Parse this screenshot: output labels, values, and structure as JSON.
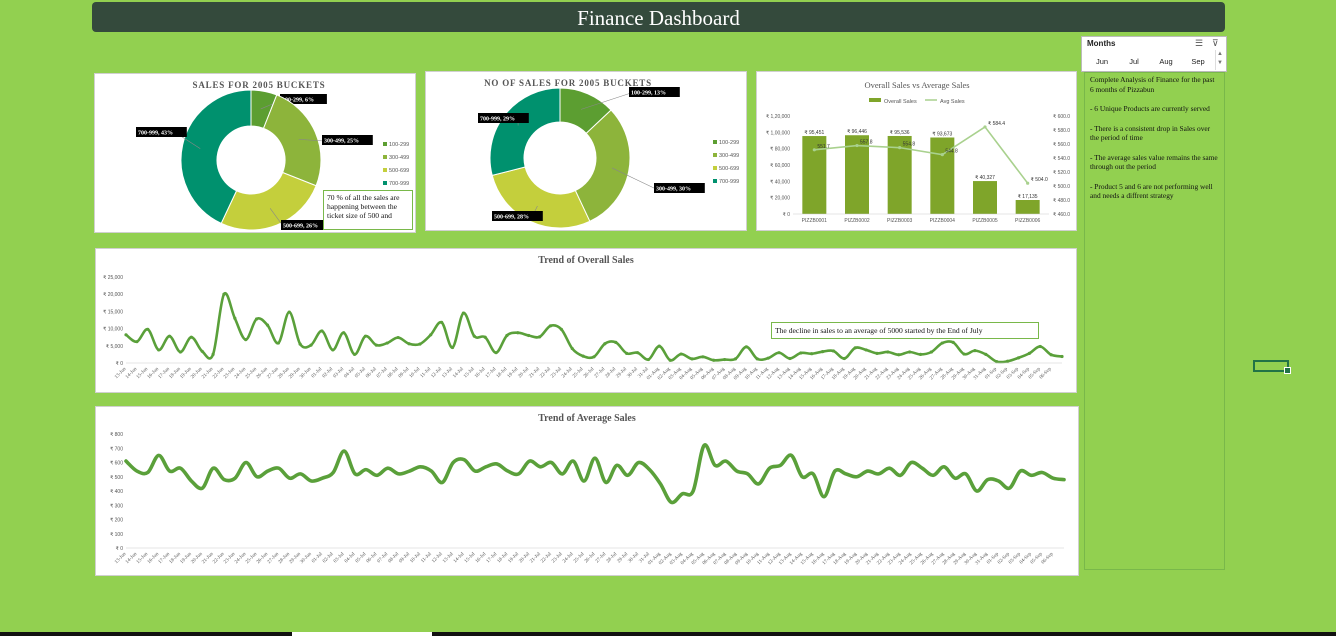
{
  "dashboard": {
    "title": "Finance Dashboard"
  },
  "slicer": {
    "title": "Months",
    "months": [
      "Jun",
      "Jul",
      "Aug",
      "Sep"
    ]
  },
  "notes": [
    "Complete Analysis of Finance for the past 6 months of Pizzabun",
    "- 6 Unique Products are currently served",
    "- There is a consistent drop in Sales over the period of time",
    "- The average sales value remains the same through out the period",
    "- Product 5 and 6 are not performing well and needs a diffrent strategy"
  ],
  "callouts": {
    "donut1": "70 % of all the sales are happening between the ticket size of 500 and",
    "trend": "The decline in sales to an average of 5000 started by the End of July"
  },
  "colors": {
    "background": "#92d050",
    "title_bar": "#344a3c",
    "seg_100_299": "#5c9e31",
    "seg_300_499": "#8db43b",
    "seg_500_699": "#c4cf3c",
    "seg_700_999": "#00916e",
    "bar": "#7fa52a",
    "avg_line": "#a9d18e",
    "trend_line": "#5aa03a"
  },
  "chart_data": [
    {
      "type": "pie",
      "title": "SALES FOR 2005 BUCKETS",
      "categories": [
        "100-299",
        "300-499",
        "500-699",
        "700-999"
      ],
      "values": [
        6,
        25,
        26,
        43
      ],
      "data_labels": [
        "100-299, 6%",
        "300-499, 25%",
        "500-699, 26%",
        "700-999, 43%"
      ],
      "legend": [
        "100-299",
        "300-499",
        "500-699",
        "700-999"
      ],
      "legend_position": "right"
    },
    {
      "type": "pie",
      "title": "NO OF SALES FOR 2005 BUCKETS",
      "categories": [
        "100-299",
        "300-499",
        "500-699",
        "700-999"
      ],
      "values": [
        13,
        30,
        28,
        29
      ],
      "data_labels": [
        "100-299, 13%",
        "300-499, 30%",
        "500-699, 28%",
        "700-999, 29%"
      ],
      "legend": [
        "100-299",
        "300-499",
        "500-699",
        "700-999"
      ],
      "legend_position": "right"
    },
    {
      "type": "bar",
      "title": "Overall Sales vs Average Sales",
      "categories": [
        "PIZZB0001",
        "PIZZB0002",
        "PIZZB0003",
        "PIZZB0004",
        "PIZZB0005",
        "PIZZB0006"
      ],
      "series": [
        {
          "name": "Overall Sales",
          "values": [
            95451,
            96446,
            95536,
            93673,
            40327,
            17135
          ],
          "labels": [
            "₹ 95,451",
            "₹ 96,446",
            "₹ 95,536",
            "₹ 93,673",
            "₹ 40,327",
            "₹ 17,135"
          ]
        },
        {
          "name": "Avg Sales",
          "values": [
            551.7,
            557.8,
            554.8,
            544.8,
            584.4,
            504.0
          ],
          "labels": [
            "551.7",
            "557.8",
            "554.8",
            "544.8",
            "₹ 584.4",
            "₹ 504.0"
          ]
        }
      ],
      "y_ticks": [
        "₹ 0",
        "₹ 20,000",
        "₹ 40,000",
        "₹ 60,000",
        "₹ 80,000",
        "₹ 1,00,000",
        "₹ 1,20,000"
      ],
      "y2_ticks": [
        "₹ 460.0",
        "₹ 480.0",
        "₹ 500.0",
        "₹ 520.0",
        "₹ 540.0",
        "₹ 560.0",
        "₹ 580.0",
        "₹ 600.0"
      ],
      "ylim": [
        0,
        120000
      ],
      "y2lim": [
        460,
        600
      ],
      "legend_position": "top"
    },
    {
      "type": "line",
      "title": "Trend of Overall Sales",
      "x": [
        "13-Jun",
        "14-Jun",
        "15-Jun",
        "16-Jun",
        "17-Jun",
        "18-Jun",
        "19-Jun",
        "20-Jun",
        "21-Jun",
        "22-Jun",
        "23-Jun",
        "24-Jun",
        "25-Jun",
        "26-Jun",
        "27-Jun",
        "28-Jun",
        "29-Jun",
        "30-Jun",
        "01-Jul",
        "02-Jul",
        "03-Jul",
        "04-Jul",
        "05-Jul",
        "06-Jul",
        "07-Jul",
        "08-Jul",
        "09-Jul",
        "10-Jul",
        "11-Jul",
        "12-Jul",
        "13-Jul",
        "14-Jul",
        "15-Jul",
        "16-Jul",
        "17-Jul",
        "18-Jul",
        "19-Jul",
        "20-Jul",
        "21-Jul",
        "22-Jul",
        "23-Jul",
        "24-Jul",
        "25-Jul",
        "26-Jul",
        "27-Jul",
        "28-Jul",
        "29-Jul",
        "30-Jul",
        "31-Jul",
        "01-Aug",
        "02-Aug",
        "03-Aug",
        "04-Aug",
        "05-Aug",
        "06-Aug",
        "07-Aug",
        "08-Aug",
        "09-Aug",
        "10-Aug",
        "11-Aug",
        "12-Aug",
        "13-Aug",
        "14-Aug",
        "15-Aug",
        "16-Aug",
        "17-Aug",
        "18-Aug",
        "19-Aug",
        "20-Aug",
        "21-Aug",
        "22-Aug",
        "23-Aug",
        "24-Aug",
        "25-Aug",
        "26-Aug",
        "27-Aug",
        "28-Aug",
        "29-Aug",
        "30-Aug",
        "31-Aug",
        "01-Sep",
        "02-Sep",
        "03-Sep",
        "04-Sep",
        "05-Sep",
        "06-Sep"
      ],
      "values": [
        8200,
        6200,
        9800,
        3800,
        7800,
        3200,
        7500,
        3400,
        2500,
        20000,
        13000,
        6800,
        12800,
        11000,
        5800,
        14800,
        5500,
        5200,
        9300,
        3800,
        8800,
        2500,
        7800,
        5200,
        5800,
        7400,
        5600,
        5500,
        8200,
        11800,
        4500,
        14500,
        7800,
        7500,
        3000,
        8000,
        8800,
        8000,
        7600,
        10800,
        9800,
        4200,
        2000,
        1800,
        5600,
        6000,
        2800,
        3000,
        1000,
        4900,
        800,
        2600,
        1200,
        1800,
        800,
        1000,
        1200,
        4700,
        1200,
        1400,
        3000,
        1300,
        2900,
        2700,
        3300,
        3500,
        1300,
        4400,
        3800,
        2800,
        3200,
        2400,
        3200,
        2500,
        3200,
        5800,
        6000,
        2600,
        3600,
        2500,
        400,
        500,
        1500,
        2800,
        4800,
        2400,
        1900
      ],
      "y_ticks": [
        "₹ 0",
        "₹ 5,000",
        "₹ 10,000",
        "₹ 15,000",
        "₹ 20,000",
        "₹ 25,000"
      ],
      "ylim": [
        0,
        25000
      ]
    },
    {
      "type": "line",
      "title": "Trend of Average Sales",
      "x": [
        "13-Jun",
        "14-Jun",
        "15-Jun",
        "16-Jun",
        "17-Jun",
        "18-Jun",
        "19-Jun",
        "20-Jun",
        "21-Jun",
        "22-Jun",
        "23-Jun",
        "24-Jun",
        "25-Jun",
        "26-Jun",
        "27-Jun",
        "28-Jun",
        "29-Jun",
        "30-Jun",
        "01-Jul",
        "02-Jul",
        "03-Jul",
        "04-Jul",
        "05-Jul",
        "06-Jul",
        "07-Jul",
        "08-Jul",
        "09-Jul",
        "10-Jul",
        "11-Jul",
        "12-Jul",
        "13-Jul",
        "14-Jul",
        "15-Jul",
        "16-Jul",
        "17-Jul",
        "18-Jul",
        "19-Jul",
        "20-Jul",
        "21-Jul",
        "22-Jul",
        "23-Jul",
        "24-Jul",
        "25-Jul",
        "26-Jul",
        "27-Jul",
        "28-Jul",
        "29-Jul",
        "30-Jul",
        "31-Jul",
        "01-Aug",
        "02-Aug",
        "03-Aug",
        "04-Aug",
        "05-Aug",
        "06-Aug",
        "07-Aug",
        "08-Aug",
        "09-Aug",
        "10-Aug",
        "11-Aug",
        "12-Aug",
        "13-Aug",
        "14-Aug",
        "15-Aug",
        "16-Aug",
        "17-Aug",
        "18-Aug",
        "19-Aug",
        "20-Aug",
        "21-Aug",
        "22-Aug",
        "23-Aug",
        "24-Aug",
        "25-Aug",
        "26-Aug",
        "27-Aug",
        "28-Aug",
        "29-Aug",
        "30-Aug",
        "31-Aug",
        "01-Sep",
        "02-Sep",
        "03-Sep",
        "04-Sep",
        "05-Sep",
        "06-Sep"
      ],
      "values": [
        610,
        540,
        530,
        650,
        540,
        560,
        470,
        420,
        560,
        480,
        490,
        600,
        500,
        540,
        560,
        490,
        520,
        470,
        490,
        530,
        680,
        520,
        550,
        510,
        560,
        520,
        540,
        570,
        540,
        460,
        600,
        620,
        540,
        570,
        590,
        540,
        520,
        610,
        570,
        600,
        520,
        610,
        470,
        630,
        460,
        580,
        510,
        600,
        550,
        450,
        320,
        380,
        400,
        720,
        580,
        610,
        540,
        520,
        450,
        560,
        580,
        650,
        500,
        520,
        360,
        540,
        520,
        500,
        540,
        520,
        560,
        510,
        600,
        560,
        510,
        570,
        490,
        520,
        400,
        480,
        470,
        420,
        540,
        510,
        530,
        490,
        480
      ],
      "y_ticks": [
        "₹ 0",
        "₹ 100",
        "₹ 200",
        "₹ 300",
        "₹ 400",
        "₹ 500",
        "₹ 600",
        "₹ 700",
        "₹ 800"
      ],
      "ylim": [
        0,
        800
      ]
    }
  ]
}
